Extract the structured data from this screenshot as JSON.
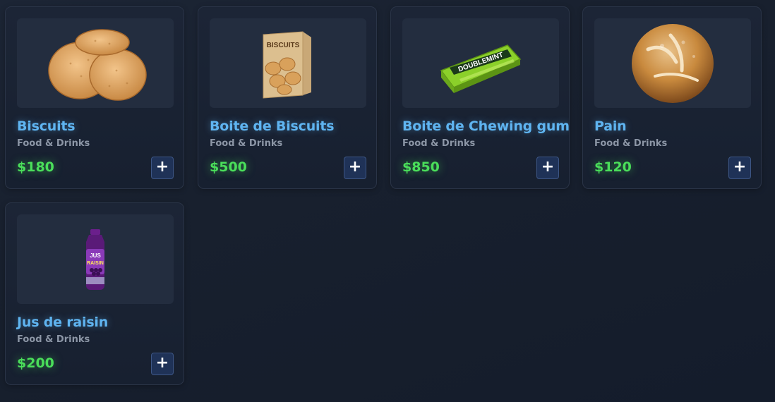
{
  "products": [
    {
      "name": "Biscuits",
      "category": "Food & Drinks",
      "price": "$180",
      "add_label": "+",
      "image": "biscuits-icon"
    },
    {
      "name": "Boite de Biscuits",
      "category": "Food & Drinks",
      "price": "$500",
      "add_label": "+",
      "image": "biscuit-box-icon"
    },
    {
      "name": "Boite de Chewing gum",
      "category": "Food & Drinks",
      "price": "$850",
      "add_label": "+",
      "image": "chewing-gum-icon"
    },
    {
      "name": "Pain",
      "category": "Food & Drinks",
      "price": "$120",
      "add_label": "+",
      "image": "bread-icon"
    },
    {
      "name": "Jus de raisin",
      "category": "Food & Drinks",
      "price": "$200",
      "add_label": "+",
      "image": "grape-juice-icon"
    }
  ],
  "image_text": {
    "box_label": "BISCUITS",
    "gum_label": "DOUBLEMINT",
    "juice_label_1": "JUS",
    "juice_label_2": "RAISIN"
  },
  "colors": {
    "name": "#5fb4f0",
    "price": "#4ade5a",
    "category": "#8c96a6",
    "add_button": "#1f3257"
  }
}
